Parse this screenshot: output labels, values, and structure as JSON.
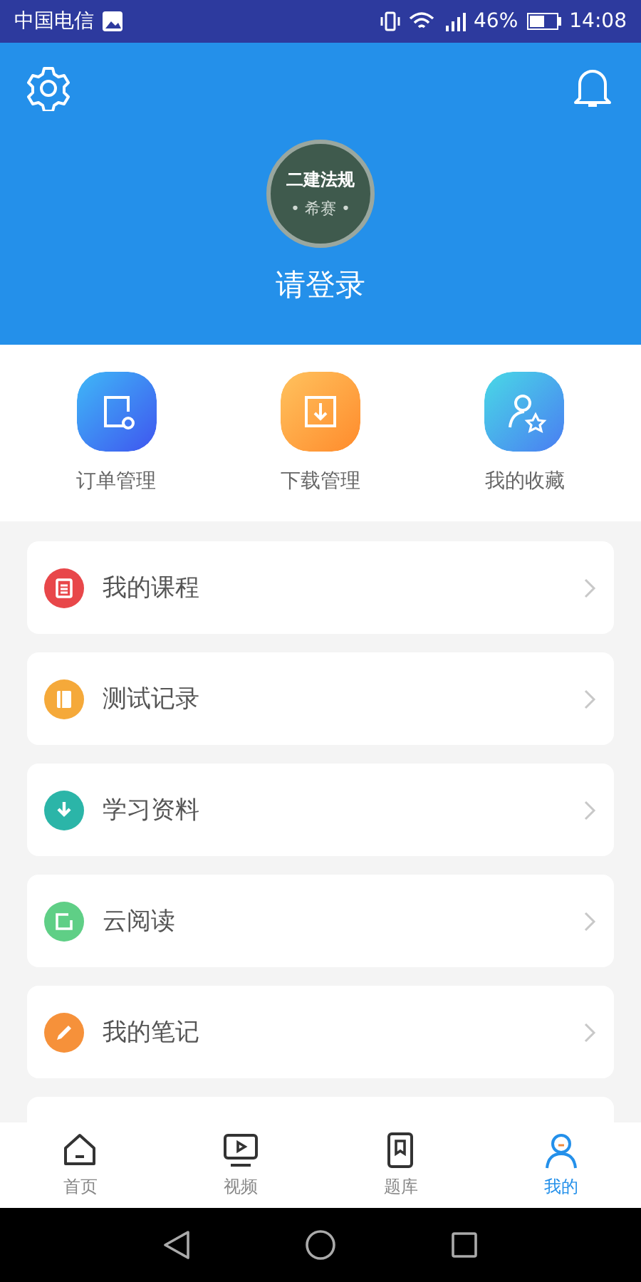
{
  "status_bar": {
    "carrier": "中国电信",
    "battery": "46%",
    "time": "14:08"
  },
  "profile": {
    "avatar_title": "二建法规",
    "avatar_subtitle": "• 希赛 •",
    "login": "请登录"
  },
  "shortcuts": [
    {
      "label": "订单管理",
      "kind": "order"
    },
    {
      "label": "下载管理",
      "kind": "download"
    },
    {
      "label": "我的收藏",
      "kind": "favorite"
    }
  ],
  "menu": [
    {
      "label": "我的课程",
      "kind": "course",
      "color": "#e8474a"
    },
    {
      "label": "测试记录",
      "kind": "record",
      "color": "#f5a93a"
    },
    {
      "label": "学习资料",
      "kind": "material",
      "color": "#2bb5a8"
    },
    {
      "label": "云阅读",
      "kind": "reading",
      "color": "#5fcf86"
    },
    {
      "label": "我的笔记",
      "kind": "note",
      "color": "#f6913a"
    }
  ],
  "tabs": [
    {
      "label": "首页",
      "kind": "home",
      "selected": false
    },
    {
      "label": "视频",
      "kind": "video",
      "selected": false
    },
    {
      "label": "题库",
      "kind": "bank",
      "selected": false
    },
    {
      "label": "我的",
      "kind": "me",
      "selected": true
    }
  ]
}
